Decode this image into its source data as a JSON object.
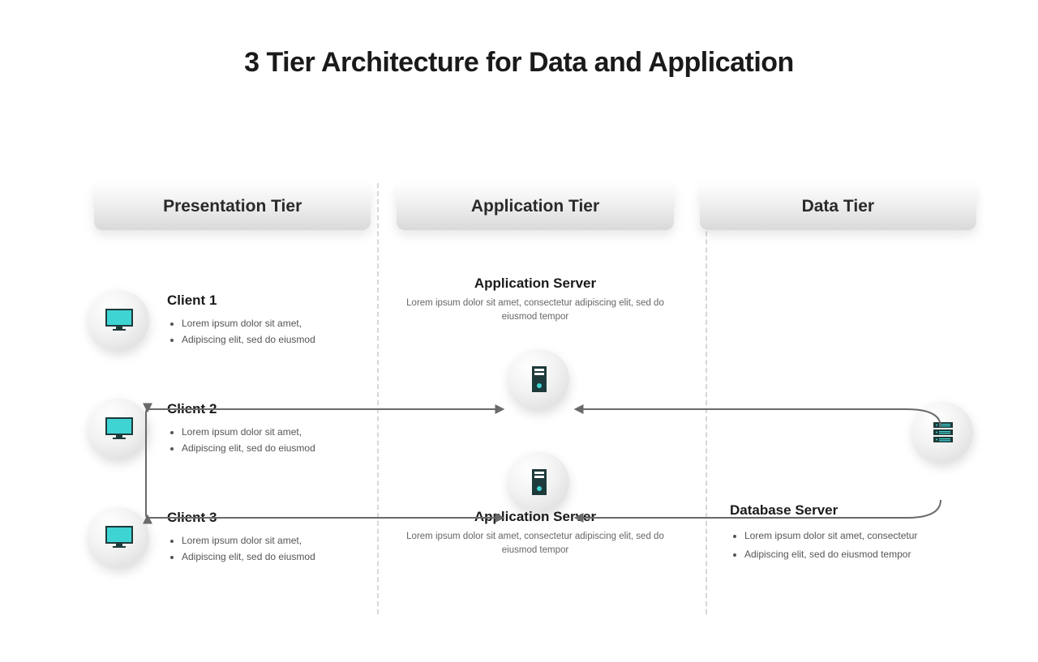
{
  "title": "3 Tier Architecture for Data and Application",
  "tiers": {
    "presentation": {
      "label": "Presentation Tier"
    },
    "application": {
      "label": "Application Tier"
    },
    "data": {
      "label": "Data Tier"
    }
  },
  "clients": [
    {
      "name": "Client 1",
      "b1": "Lorem ipsum dolor sit amet,",
      "b2": "Adipiscing elit, sed do eiusmod"
    },
    {
      "name": "Client 2",
      "b1": "Lorem ipsum dolor sit amet,",
      "b2": "Adipiscing elit, sed do eiusmod"
    },
    {
      "name": "Client 3",
      "b1": "Lorem ipsum dolor sit amet,",
      "b2": "Adipiscing elit, sed do eiusmod"
    }
  ],
  "app_server": {
    "title": "Application Server",
    "desc": "Lorem ipsum dolor sit amet, consectetur adipiscing elit, sed do eiusmod tempor"
  },
  "db_server": {
    "title": "Database Server",
    "b1": "Lorem ipsum dolor sit amet, consectetur",
    "b2": "Adipiscing elit, sed do eiusmod tempor"
  },
  "colors": {
    "accent": "#3fd4d4",
    "dark": "#1f3a3a",
    "arrow": "#6a6a6a"
  }
}
